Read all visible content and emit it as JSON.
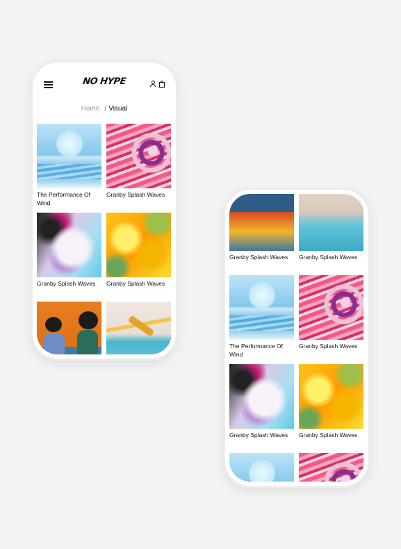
{
  "header": {
    "logo": "NO HYPE",
    "icons": [
      "menu-icon",
      "user-icon",
      "bag-icon"
    ]
  },
  "breadcrumb": {
    "home": "Home",
    "separator": "/",
    "current": "Visual"
  },
  "products": {
    "performance": "The Performance Of Wind",
    "granby": "Granby Splash Waves"
  },
  "phone1_cards": [
    {
      "art": "art-sun",
      "title": "The Performance Of Wind"
    },
    {
      "art": "art-swirl",
      "title": "Granby Splash Waves"
    },
    {
      "art": "art-white",
      "title": "Granby Splash Waves"
    },
    {
      "art": "art-yellow",
      "title": "Granby Splash Waves"
    },
    {
      "art": "art-women",
      "title": ""
    },
    {
      "art": "art-dive",
      "title": ""
    }
  ],
  "phone2_cards": [
    {
      "art": "art-crop-bottom",
      "title": "Granby Splash Waves"
    },
    {
      "art": "art-crop-bottom2",
      "title": "Granby Splash Waves"
    },
    {
      "art": "art-sun",
      "title": "The Performance Of Wind"
    },
    {
      "art": "art-swirl",
      "title": "Granby Splash Waves"
    },
    {
      "art": "art-white",
      "title": "Granby Splash Waves"
    },
    {
      "art": "art-yellow",
      "title": "Granby Splash Waves"
    },
    {
      "art": "art-sun",
      "title": ""
    },
    {
      "art": "art-swirl",
      "title": ""
    }
  ],
  "colors": {
    "background": "#f3f3f3",
    "text": "#111111",
    "muted": "#999999"
  }
}
